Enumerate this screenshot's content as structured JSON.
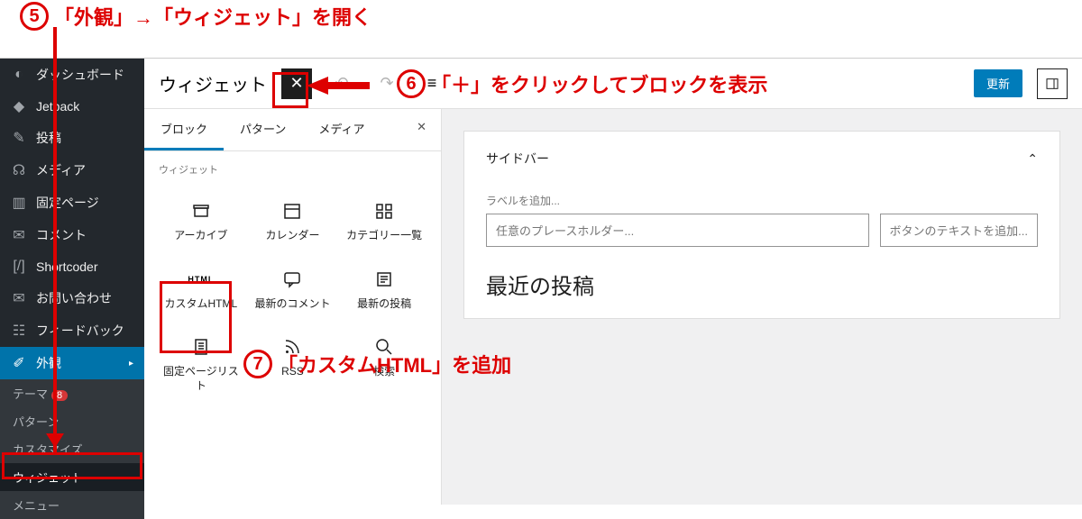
{
  "annotations": {
    "step5": "「外観」→「ウィジェット」を開く",
    "step6": "「＋」をクリックしてブロックを表示",
    "step7": "「カスタムHTML」を追加"
  },
  "sidebar": {
    "items": [
      {
        "label": "ダッシュボード",
        "icon": "dashboard"
      },
      {
        "label": "Jetpack",
        "icon": "jetpack"
      },
      {
        "label": "投稿",
        "icon": "pin"
      },
      {
        "label": "メディア",
        "icon": "media"
      },
      {
        "label": "固定ページ",
        "icon": "page"
      },
      {
        "label": "コメント",
        "icon": "comment"
      },
      {
        "label": "Shortcoder",
        "icon": "shortcode"
      },
      {
        "label": "お問い合わせ",
        "icon": "mail"
      },
      {
        "label": "フィードバック",
        "icon": "feedback"
      }
    ],
    "active": {
      "label": "外観",
      "icon": "brush"
    },
    "sub": [
      {
        "label": "テーマ",
        "badge": "8"
      },
      {
        "label": "パターン"
      },
      {
        "label": "カスタマイズ"
      },
      {
        "label": "ウィジェット",
        "selected": true
      },
      {
        "label": "メニュー"
      }
    ]
  },
  "topbar": {
    "title": "ウィジェット",
    "update": "更新"
  },
  "inserter": {
    "tabs": [
      "ブロック",
      "パターン",
      "メディア"
    ],
    "section": "ウィジェット",
    "blocks": [
      {
        "label": "アーカイブ",
        "icon": "archive"
      },
      {
        "label": "カレンダー",
        "icon": "calendar"
      },
      {
        "label": "カテゴリー一覧",
        "icon": "categories"
      },
      {
        "label": "カスタムHTML",
        "icon": "html"
      },
      {
        "label": "最新のコメント",
        "icon": "latestcomments"
      },
      {
        "label": "最新の投稿",
        "icon": "latestposts"
      },
      {
        "label": "固定ページリスト",
        "icon": "pagelist"
      },
      {
        "label": "RSS",
        "icon": "rss"
      },
      {
        "label": "検索",
        "icon": "search"
      }
    ]
  },
  "canvas": {
    "area_title": "サイドバー",
    "label_hint": "ラベルを追加...",
    "placeholder": "任意のプレースホルダー...",
    "button_text": "ボタンのテキストを追加...",
    "recent": "最近の投稿"
  }
}
